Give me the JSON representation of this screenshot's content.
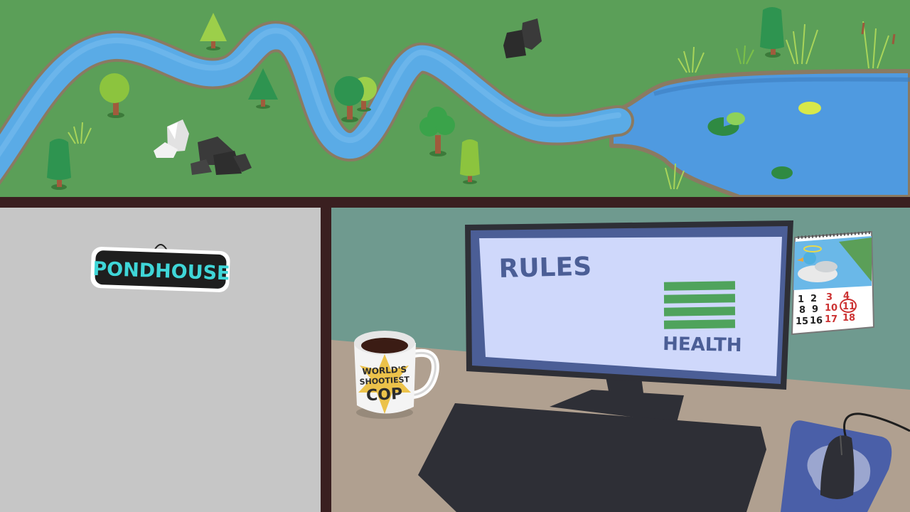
{
  "sign": {
    "text": "PONDHOUSE"
  },
  "monitor": {
    "title": "RULES",
    "health_label": "HEALTH",
    "health_level": 4,
    "health_max": 4
  },
  "mug": {
    "line1": "WORLD'S",
    "line2": "SHOOTIEST",
    "line3": "COP"
  },
  "calendar": {
    "rows": [
      [
        {
          "d": "1",
          "c": "#222222"
        },
        {
          "d": "2",
          "c": "#222222"
        },
        {
          "d": "3",
          "c": "#cc3333"
        },
        {
          "d": "4",
          "c": "#cc3333"
        }
      ],
      [
        {
          "d": "8",
          "c": "#222222"
        },
        {
          "d": "9",
          "c": "#222222"
        },
        {
          "d": "10",
          "c": "#cc3333"
        },
        {
          "d": "11",
          "c": "#cc3333"
        }
      ],
      [
        {
          "d": "15",
          "c": "#222222"
        },
        {
          "d": "16",
          "c": "#222222"
        },
        {
          "d": "17",
          "c": "#cc3333"
        },
        {
          "d": "18",
          "c": "#cc3333"
        }
      ]
    ],
    "circled": "11"
  },
  "colors": {
    "grass": "#5b9f58",
    "river": "#5aabe6",
    "pond": "#4f9ae0",
    "frame": "#3a1f20",
    "wall": "#6f9a8f",
    "desk": "#b0a090",
    "panel": "#c6c6c6",
    "screen": "#cfd8fb",
    "health_bar": "#4fa35c",
    "mousepad": "#4a5fa8"
  }
}
